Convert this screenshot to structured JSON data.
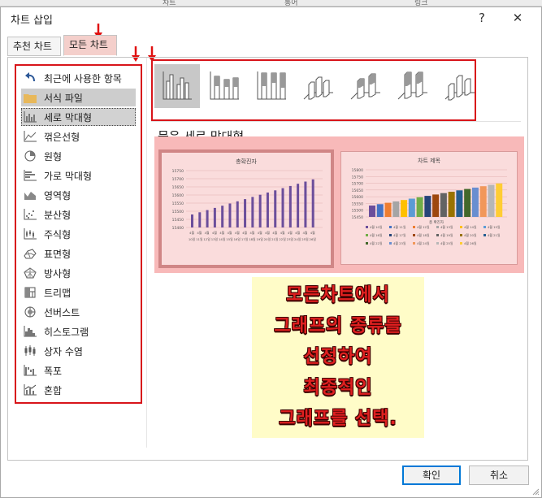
{
  "window": {
    "title": "차트 삽입",
    "help_label": "?",
    "close_label": "✕"
  },
  "background_sheet": {
    "cells": [
      "차트",
      "통어",
      "링크"
    ]
  },
  "tabs": [
    {
      "label": "추천 차트"
    },
    {
      "label": "모든 차트"
    }
  ],
  "categories": [
    {
      "label": "최근에 사용한 항목",
      "icon": "recent-arrow-icon"
    },
    {
      "label": "서식 파일",
      "icon": "folder-icon"
    },
    {
      "label": "세로 막대형",
      "icon": "column-chart-icon"
    },
    {
      "label": "꺾은선형",
      "icon": "line-chart-icon"
    },
    {
      "label": "원형",
      "icon": "pie-chart-icon"
    },
    {
      "label": "가로 막대형",
      "icon": "bar-chart-icon"
    },
    {
      "label": "영역형",
      "icon": "area-chart-icon"
    },
    {
      "label": "분산형",
      "icon": "scatter-chart-icon"
    },
    {
      "label": "주식형",
      "icon": "stock-chart-icon"
    },
    {
      "label": "표면형",
      "icon": "surface-chart-icon"
    },
    {
      "label": "방사형",
      "icon": "radar-chart-icon"
    },
    {
      "label": "트리맵",
      "icon": "treemap-icon"
    },
    {
      "label": "선버스트",
      "icon": "sunburst-icon"
    },
    {
      "label": "히스토그램",
      "icon": "histogram-icon"
    },
    {
      "label": "상자 수염",
      "icon": "box-whisker-icon"
    },
    {
      "label": "폭포",
      "icon": "waterfall-icon"
    },
    {
      "label": "혼합",
      "icon": "combo-chart-icon"
    }
  ],
  "subtypes": [
    {
      "name": "clustered-column-icon"
    },
    {
      "name": "stacked-column-icon"
    },
    {
      "name": "stacked-100-column-icon"
    },
    {
      "name": "3d-clustered-column-icon"
    },
    {
      "name": "3d-stacked-column-icon"
    },
    {
      "name": "3d-stacked-100-column-icon"
    },
    {
      "name": "3d-column-icon"
    }
  ],
  "selected_subtype_label": "묶은 세로 막대형",
  "preview": {
    "first_title": "총확진자",
    "second_title": "차트 제목",
    "second_axis_label": "총 확진자",
    "y_ticks": [
      "15750",
      "15700",
      "15650",
      "15600",
      "15550",
      "15500",
      "15450",
      "15400"
    ],
    "second_y_ticks": [
      "15800",
      "15750",
      "15700",
      "15650",
      "15600",
      "15550",
      "15500",
      "15450"
    ],
    "x_labels_top": [
      "4월",
      "4월",
      "4월",
      "4월",
      "4월",
      "4월",
      "4월",
      "4월",
      "4월",
      "4월",
      "4월",
      "4월"
    ],
    "x_labels_bottom": [
      "10일",
      "11일",
      "12일",
      "13일",
      "14일",
      "15일",
      "16일",
      "17일",
      "18일",
      "19일",
      "20일",
      "21일",
      "22일",
      "23일",
      "24일",
      "25일",
      "26일"
    ],
    "legend_items": [
      "4월 10일",
      "4월 11일",
      "4월 12일",
      "4월 13일",
      "4월 14일",
      "4월 15일",
      "4월 16일",
      "4월 17일",
      "4월 18일",
      "4월 19일",
      "4월 20일",
      "4월 21일",
      "4월 22일",
      "4월 23일",
      "4월 24일",
      "4월 25일",
      "4월 26일"
    ],
    "bar_color": "#6b4e9b",
    "second_bar_colors": [
      "#6b4e9b",
      "#4472c4",
      "#ed7d31",
      "#a5a5a5",
      "#ffc000",
      "#5b9bd5",
      "#70ad47",
      "#264478",
      "#9e480e",
      "#636363",
      "#997300",
      "#255e91",
      "#43682b",
      "#698ed0",
      "#f1975a",
      "#b7b7b7",
      "#ffcd33"
    ]
  },
  "annotation_note": {
    "lines": [
      "모든차트에서",
      "그래프의 종류를",
      "선정하여",
      "최종적인",
      "그래프를 선택."
    ]
  },
  "footer": {
    "ok_label": "확인",
    "cancel_label": "취소"
  },
  "colors": {
    "highlight_red": "#d8141a",
    "selected_tab_bg": "#f4cfcb",
    "preview_bg": "#f8b9b9",
    "note_bg": "#fffcc8",
    "primary_button_border": "#0078d7"
  }
}
